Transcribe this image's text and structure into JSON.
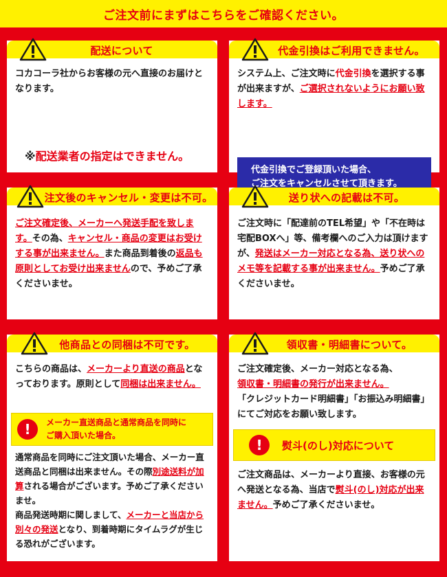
{
  "banner": "ご注文前にまずはこちらをご確認ください。",
  "panels": {
    "delivery": {
      "title": "配送について",
      "text": "コカコーラ社からお客様の元へ直接のお届けとなります。",
      "notice_mark": "※",
      "notice": "配送業者の指定はできません。"
    },
    "cod": {
      "title": "代金引換はご利用できません。",
      "text_1": "システム上、ご注文時に",
      "text_2": "代金引換",
      "text_3": "を選択する事が出来ますが、",
      "text_4": "ご選択されないようにお願い致します。",
      "box_line1": "代金引換でご登録頂いた場合、",
      "box_line2": "ご注文をキャンセルさせて頂きます。"
    },
    "cancel": {
      "title": "注文後のキャンセル・変更は不可。",
      "t1": "ご注文確定後、メーカーへ発送手配を致します。",
      "t2": "その為、",
      "t3": "キャンセル・商品の変更はお受けする事が出来ません。",
      "t4": "また商品到着後の",
      "t5": "返品も原則としてお受け出来ません",
      "t6": "ので、予めご了承くださいませ。"
    },
    "label": {
      "title": "送り状への記載は不可。",
      "t1": "ご注文時に「配達前のTEL希望」や「不在時は宅配BOXへ」等、備考欄へのご入力は頂けますが、",
      "t2": "発送はメーカー対応となる為、送り状へのメモ等を記載する事が出来ません。",
      "t3": "予めご了承くださいませ。"
    },
    "bundle": {
      "title": "他商品との同梱は不可です。",
      "t1": "こちらの商品は、",
      "t2": "メーカーより直送の商品",
      "t3": "となっております。原則として",
      "t4": "同梱は出来ません。",
      "note_line1": "メーカー直送商品と通常商品を同時に",
      "note_line2": "ご購入頂いた場合。",
      "t5": "通常商品を同時にご注文頂いた場合、メーカー直送商品と同梱は出来ません。その際",
      "t6": "別途送料が加算",
      "t7": "される場合がございます。予めご了承くださいませ。",
      "t8": "商品発送時期に関しまして、",
      "t9": "メーカーと当店から別々の発送",
      "t10": "となり、到着時期にタイムラグが生じる恐れがございます。"
    },
    "receipt": {
      "title": "領収書・明細書について。",
      "t1": "ご注文確定後、メーカー対応となる為、",
      "t2": "領収書・明細書の発行が出来ません。",
      "t3": "「クレジットカード明細書」「お振込み明細書」にてご対応をお願い致します。",
      "noshi_title": "熨斗(のし)対応について",
      "t4": "ご注文商品は、メーカーより直接、お客様の元へ発送となる為、当店で",
      "t5": "熨斗(のし)対応が出来ません。",
      "t6": "予めご了承くださいませ。"
    }
  },
  "icons": {
    "warning": "warning-triangle-icon",
    "exclamation": "exclamation-circle-icon"
  },
  "colors": {
    "background_red": "#e60012",
    "header_yellow": "#fff100",
    "notice_blue": "#2b2ba8"
  }
}
